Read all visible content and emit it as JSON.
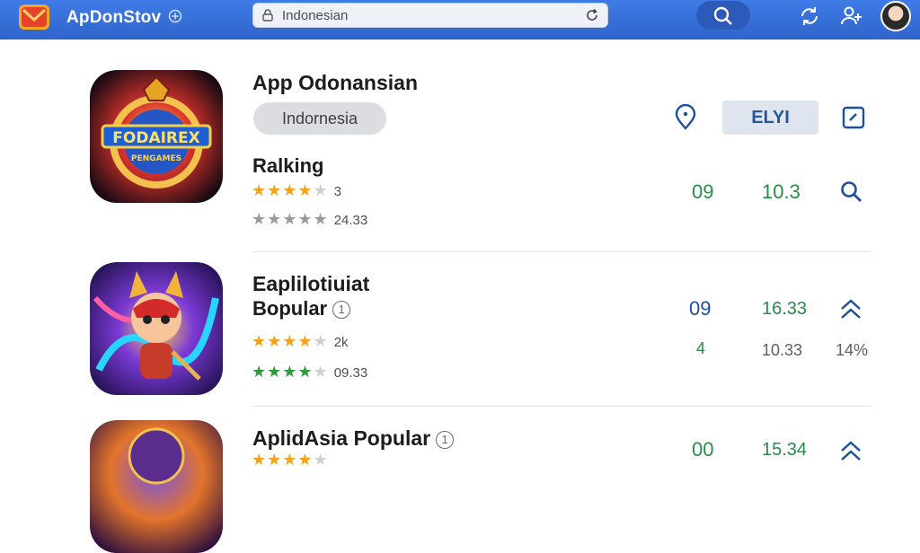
{
  "header": {
    "brand": "ApDonStov",
    "search_value": "Indonesian",
    "icons": [
      "app-logo-icon",
      "plus-circle-icon",
      "search-icon",
      "refresh-icon",
      "share-icon",
      "user-add-icon",
      "avatar"
    ]
  },
  "app1": {
    "title": "App Odonansian",
    "pill": "Indornesia",
    "section_label": "Ralking",
    "stars_primary": "3",
    "stars_secondary": "24.33",
    "col1": "09",
    "col2": "10.3",
    "button": "ELYI",
    "icons": [
      "location-pin-icon",
      "edit-square-icon",
      "search-icon"
    ]
  },
  "app2": {
    "title": "Eaplilotiuiat",
    "subtitle": "Bopular",
    "info": "1",
    "stars_primary": "2k",
    "stars_secondary": "09.33",
    "col1_top": "09",
    "col1_bottom": "4",
    "col2_top": "16.33",
    "col2_bottom": "10.33",
    "col3_bottom": "14%",
    "icons": [
      "chevron-up-double-icon"
    ]
  },
  "app3": {
    "title": "AplidAsia Popular",
    "info": "1",
    "col1": "00",
    "col2": "15.34",
    "icons": [
      "chevron-up-double-icon"
    ]
  },
  "colors": {
    "topbar": "#3f7be6",
    "accent_green": "#2a8a48",
    "accent_blue": "#1e4f9c",
    "star_gold": "#f2a31b",
    "star_grey": "#9a9a9a",
    "star_green": "#2f9a3c"
  }
}
